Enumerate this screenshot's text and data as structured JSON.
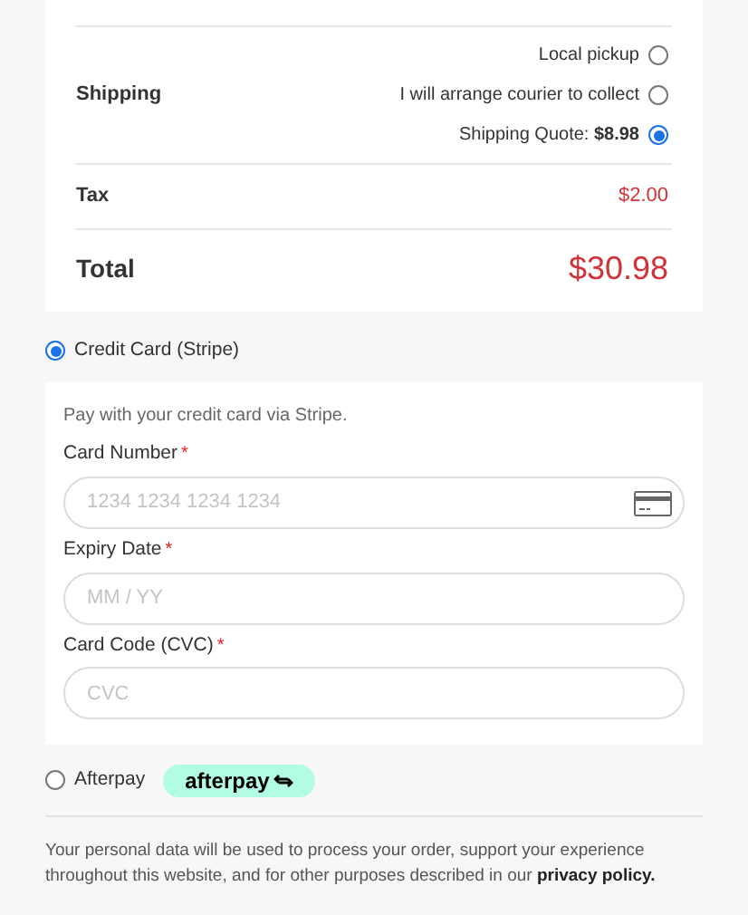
{
  "summary": {
    "shipping": {
      "label": "Shipping",
      "options": [
        {
          "label": "Local pickup",
          "selected": false
        },
        {
          "label": "I will arrange courier to collect",
          "selected": false
        },
        {
          "label": "Shipping Quote: **$8.98**",
          "selected": true
        }
      ]
    },
    "tax": {
      "label": "Tax",
      "value": "$2.00"
    },
    "total": {
      "label": "Total",
      "value": "$30.98"
    }
  },
  "payment_methods": [
    {
      "kind": "card",
      "label": "Credit Card (Stripe)",
      "selected": true,
      "description": "Pay with your credit card via Stripe.",
      "fields": [
        {
          "label": "Card Number",
          "required_mark": "*",
          "placeholder": "1234 1234 1234 1234",
          "card_icon": true
        },
        {
          "label": "Expiry Date",
          "required_mark": "*",
          "placeholder": "MM / YY",
          "card_icon": false
        },
        {
          "label": "Card Code (CVC)",
          "required_mark": "*",
          "placeholder": "CVC",
          "card_icon": false
        }
      ]
    },
    {
      "kind": "afterpay",
      "label": "Afterpay",
      "selected": false,
      "badge": "afterpay"
    }
  ],
  "privacy_text": "Your personal data will be used to process your order, support your experience throughout this website, and for other purposes described in our",
  "privacy_link": "privacy policy."
}
